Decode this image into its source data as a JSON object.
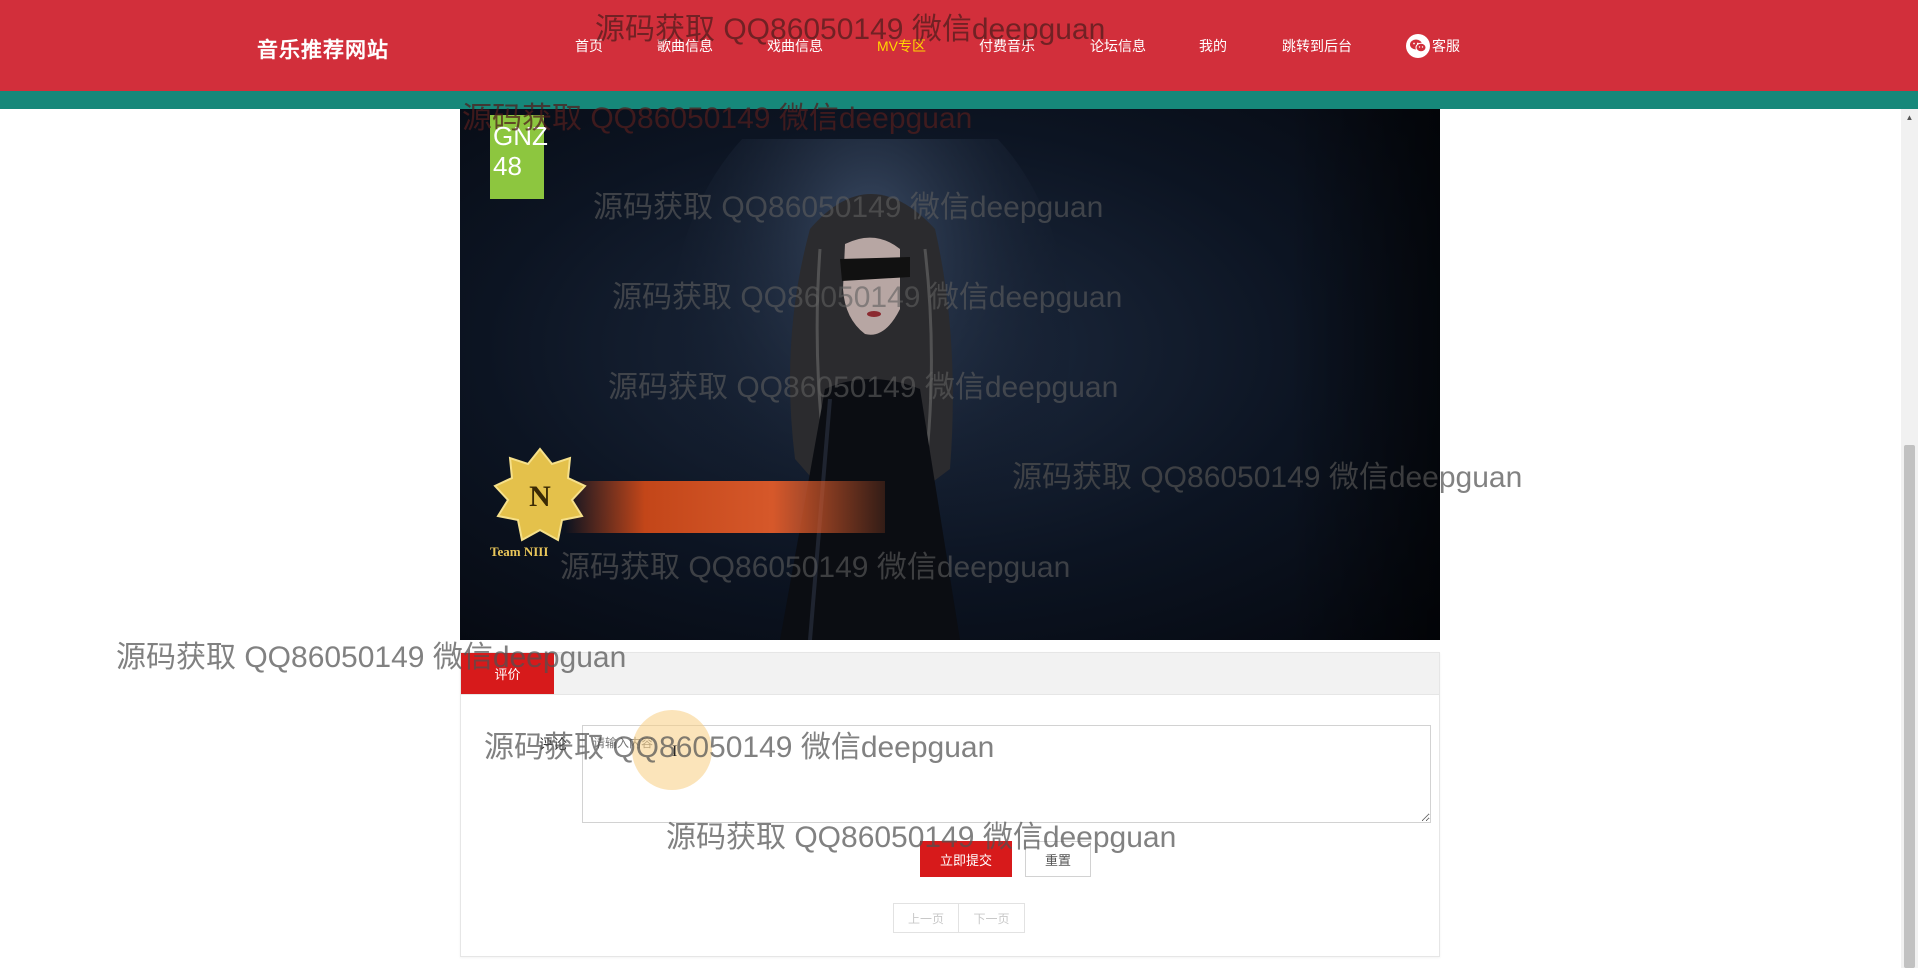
{
  "header": {
    "brand": "音乐推荐网站",
    "nav": [
      {
        "label": "首页",
        "active": false
      },
      {
        "label": "歌曲信息",
        "active": false
      },
      {
        "label": "戏曲信息",
        "active": false
      },
      {
        "label": "MV专区",
        "active": true
      },
      {
        "label": "付费音乐",
        "active": false
      },
      {
        "label": "论坛信息",
        "active": false
      },
      {
        "label": "我的",
        "active": false
      },
      {
        "label": "跳转到后台",
        "active": false
      }
    ],
    "service_label": "客服",
    "accent_color": "#d22f3b",
    "stripe_color": "#16887a",
    "active_nav_color": "#ffd700"
  },
  "video": {
    "corner_logo": [
      "GNZ",
      "48"
    ],
    "badge_team_text": "Team NIII"
  },
  "comment": {
    "tab_label": "评价",
    "field_label": "评论",
    "placeholder": "请输入内容",
    "submit_label": "立即提交",
    "reset_label": "重置",
    "prev_label": "上一页",
    "next_label": "下一页",
    "button_color": "#d71a1b"
  },
  "watermark": {
    "text": "源码获取 QQ86050149 微信deepguan"
  }
}
